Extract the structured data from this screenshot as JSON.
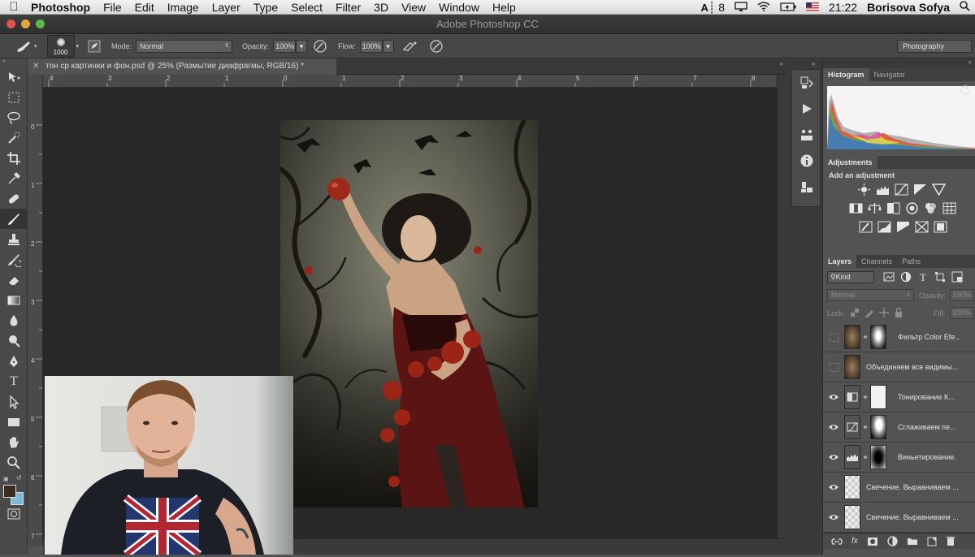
{
  "menubar": {
    "app": "Photoshop",
    "items": [
      "File",
      "Edit",
      "Image",
      "Layer",
      "Type",
      "Select",
      "Filter",
      "3D",
      "View",
      "Window",
      "Help"
    ],
    "status": {
      "ai_badge": "8",
      "time": "21:22",
      "user": "Borisova Sofya"
    }
  },
  "window": {
    "title": "Adobe Photoshop CC"
  },
  "options": {
    "brush_size": "1000",
    "mode_label": "Mode:",
    "mode_value": "Normal",
    "opacity_label": "Opacity:",
    "opacity_value": "100%",
    "flow_label": "Flow:",
    "flow_value": "100%",
    "workspace": "Photography"
  },
  "document": {
    "tab_title": "тон ср картинки и фон.psd @ 25% (Размытие диафрагмы, RGB/16) *",
    "ruler_top_labels": [
      "4",
      "3",
      "2",
      "1",
      "0",
      "1",
      "2",
      "3",
      "4",
      "5",
      "6",
      "7",
      "8",
      "9"
    ],
    "ruler_left_labels": [
      "0",
      "1",
      "2",
      "3",
      "4",
      "5",
      "6",
      "7"
    ]
  },
  "panels": {
    "histogram_tabs": [
      "Histogram",
      "Navigator"
    ],
    "adjustments_tab": "Adjustments",
    "adjustments_title": "Add an adjustment",
    "layers_tabs": [
      "Layers",
      "Channels",
      "Paths"
    ],
    "kind_label": "Kind",
    "blend_mode": "Normal",
    "opacity_label": "Opacity:",
    "opacity_value": "100%",
    "lock_label": "Lock:",
    "fill_label": "Fill:",
    "fill_value": "100%"
  },
  "layers": [
    {
      "name": "Фильтр Color Efe...",
      "visible": false,
      "thumb": "photo",
      "mask": "face"
    },
    {
      "name": "Объединяем все видимы...",
      "visible": false,
      "thumb": "photo",
      "mask": "none"
    },
    {
      "name": "Тонирование К...",
      "visible": true,
      "thumb": "adjust",
      "mask": "white"
    },
    {
      "name": "Сглаживаем пе...",
      "visible": true,
      "thumb": "curves",
      "mask": "face"
    },
    {
      "name": "Виньетирование.",
      "visible": true,
      "thumb": "levels",
      "mask": "dark"
    },
    {
      "name": "Свечение. Выравниваем ...",
      "visible": true,
      "thumb": "transparent",
      "mask": "none"
    },
    {
      "name": "Свечение. Выравниваем ...",
      "visible": true,
      "thumb": "transparent",
      "mask": "none"
    }
  ],
  "colors": {
    "foreground": "#3a2a20",
    "background": "#7db8d8"
  }
}
